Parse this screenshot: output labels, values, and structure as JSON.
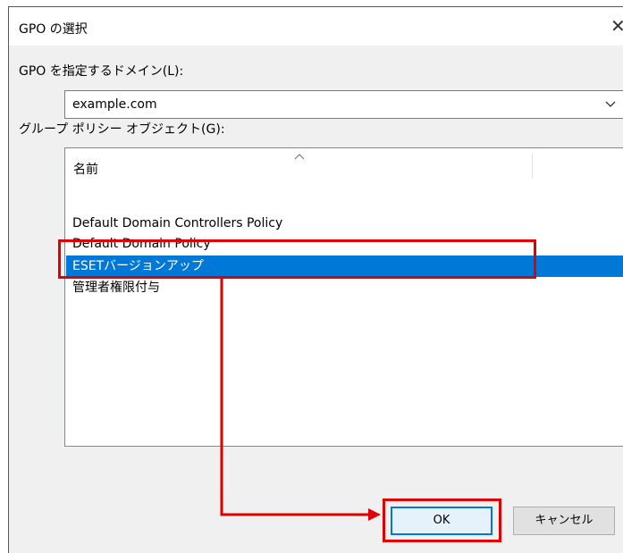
{
  "dialog": {
    "title": "GPO の選択",
    "close_icon": "close-icon"
  },
  "domain": {
    "label": "GPO を指定するドメイン(L):",
    "value": "example.com"
  },
  "gpo": {
    "label": "グループ ポリシー オブジェクト(G):",
    "column_header": "名前",
    "items": [
      {
        "label": "Default Domain Controllers Policy",
        "selected": false
      },
      {
        "label": "Default Domain Policy",
        "selected": false
      },
      {
        "label": "ESETバージョンアップ",
        "selected": true
      },
      {
        "label": "管理者権限付与",
        "selected": false
      }
    ]
  },
  "buttons": {
    "ok": "OK",
    "cancel": "キャンセル"
  },
  "colors": {
    "selection": "#0078d7",
    "annotation": "#e00000",
    "dialog_bg": "#f0f0f0"
  }
}
